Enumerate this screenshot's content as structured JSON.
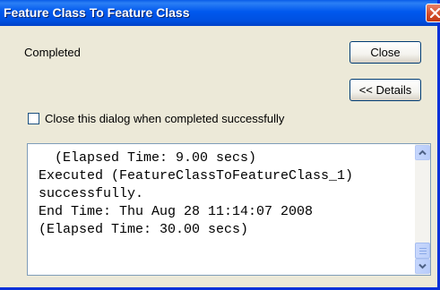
{
  "window": {
    "title": "Feature Class To Feature Class"
  },
  "status": {
    "text": "Completed"
  },
  "buttons": {
    "close_label": "Close",
    "details_label": "<< Details"
  },
  "options": {
    "close_on_success_label": "Close this dialog when completed successfully",
    "close_on_success_checked": false
  },
  "log": {
    "lines": [
      "  (Elapsed Time: 9.00 secs)",
      "Executed (FeatureClassToFeatureClass_1)",
      "successfully.",
      "End Time: Thu Aug 28 11:14:07 2008",
      "(Elapsed Time: 30.00 secs)"
    ]
  },
  "icons": {
    "title_close": "close-icon",
    "scroll_up": "chevron-up-icon",
    "scroll_down": "chevron-down-icon"
  },
  "colors": {
    "titlebar": "#0058ee",
    "window_bg": "#ece9d8",
    "close_button": "#d24a26"
  }
}
